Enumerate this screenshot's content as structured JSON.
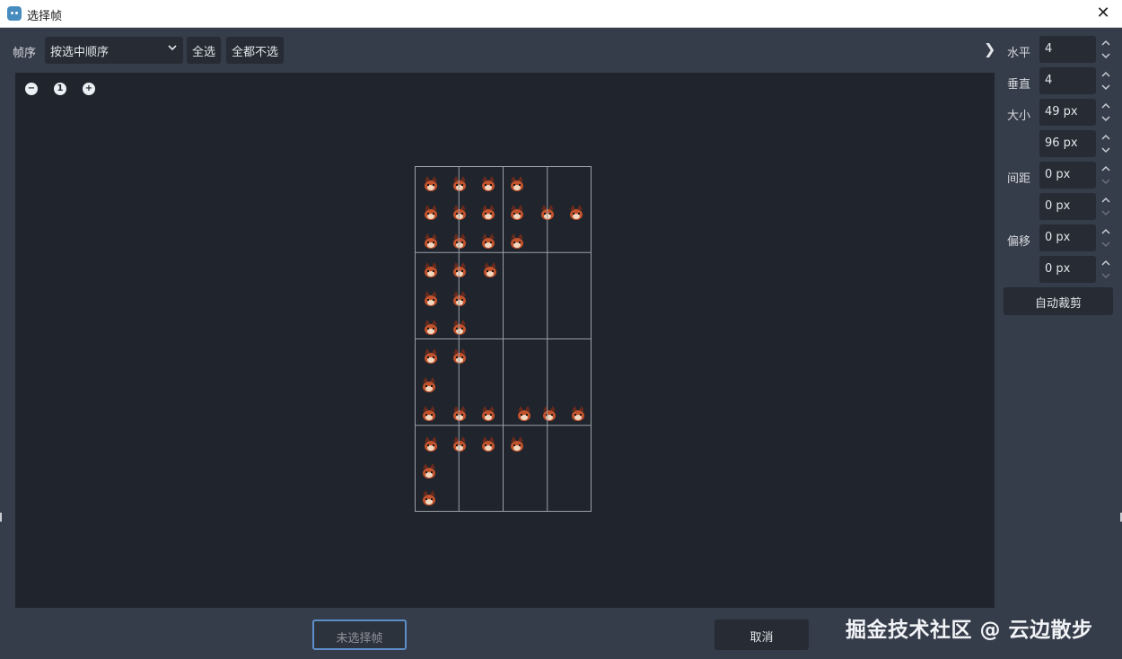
{
  "window": {
    "title": "选择帧",
    "close_glyph": "✕"
  },
  "toolbar": {
    "order_label": "帧序",
    "order_value": "按选中顺序",
    "select_all": "全选",
    "select_none": "全都不选",
    "collapse_glyph": "❯"
  },
  "zoom": {
    "out": "−",
    "reset": "1",
    "in": "+"
  },
  "panel": {
    "horizontal_label": "水平",
    "horizontal_value": "4",
    "vertical_label": "垂直",
    "vertical_value": "4",
    "size_label": "大小",
    "size_x": "49 px",
    "size_y": "96 px",
    "separation_label": "间距",
    "separation_x": "0 px",
    "separation_y": "0 px",
    "offset_label": "偏移",
    "offset_x": "0 px",
    "offset_y": "0 px",
    "auto_slice": "自动裁剪"
  },
  "footer": {
    "no_frames": "未选择帧",
    "cancel": "取消"
  },
  "watermark": "掘金技术社区 @ 云边散步",
  "grid": {
    "columns": 4,
    "rows": 4
  },
  "colors": {
    "fur": "#c2522c",
    "dark": "#6a2a1c",
    "light": "#f1d8c0"
  }
}
